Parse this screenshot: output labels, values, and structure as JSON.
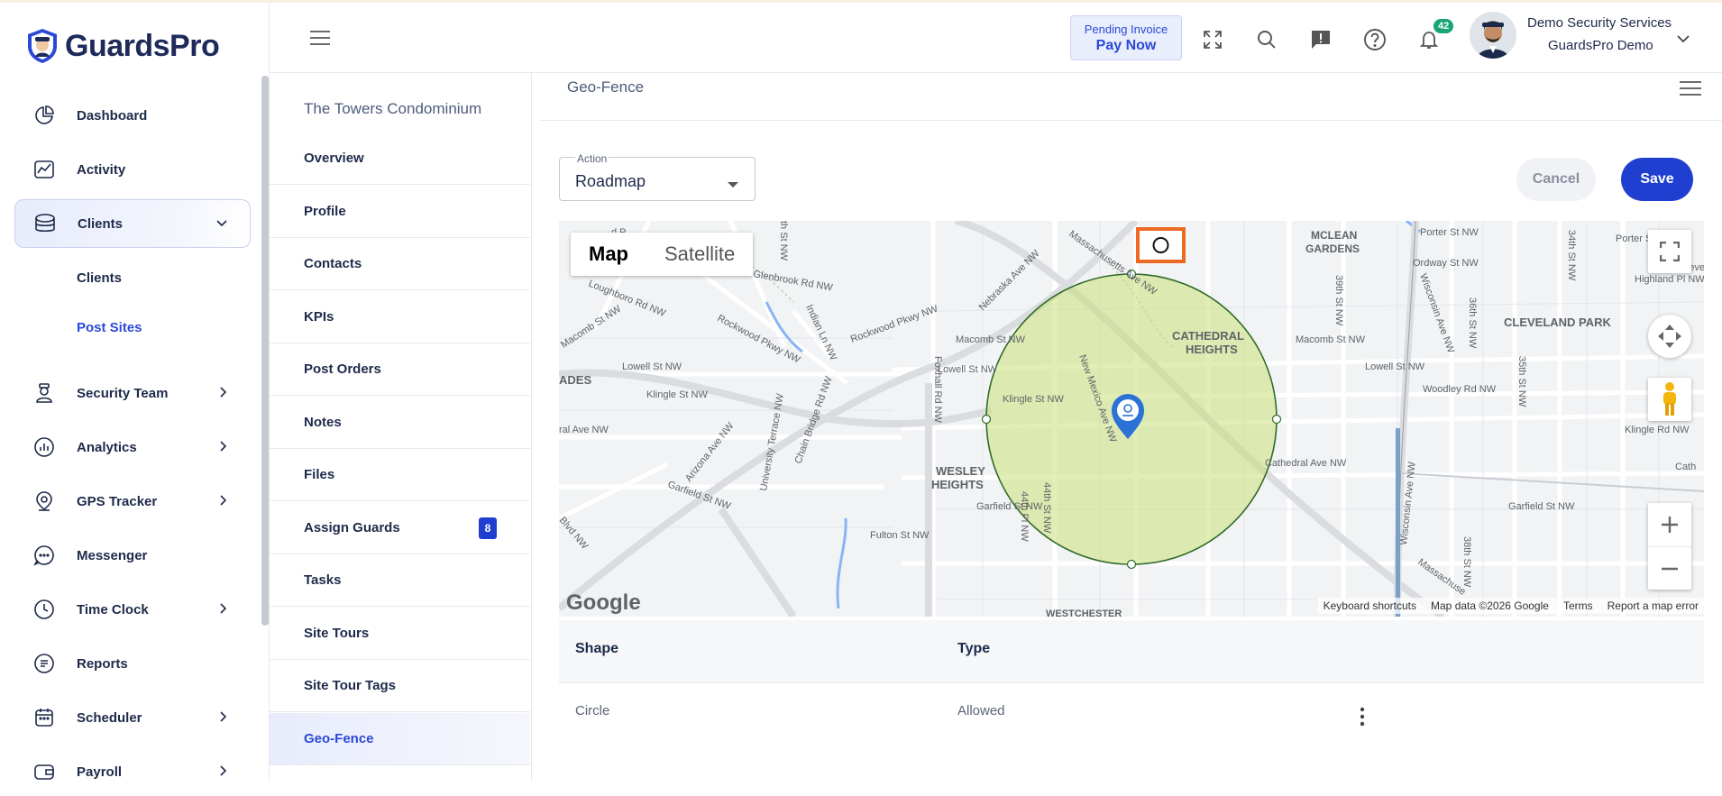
{
  "brand": {
    "name": "GuardsPro"
  },
  "sidebar": {
    "items": [
      {
        "label": "Dashboard",
        "icon": "dashboard-icon"
      },
      {
        "label": "Activity",
        "icon": "activity-icon"
      },
      {
        "label": "Clients",
        "icon": "clients-icon",
        "expanded": true
      },
      {
        "label": "Security Team",
        "icon": "security-team-icon"
      },
      {
        "label": "Analytics",
        "icon": "analytics-icon"
      },
      {
        "label": "GPS Tracker",
        "icon": "gps-tracker-icon"
      },
      {
        "label": "Messenger",
        "icon": "messenger-icon"
      },
      {
        "label": "Time Clock",
        "icon": "time-clock-icon"
      },
      {
        "label": "Reports",
        "icon": "reports-icon"
      },
      {
        "label": "Scheduler",
        "icon": "scheduler-icon"
      },
      {
        "label": "Payroll",
        "icon": "payroll-icon"
      }
    ],
    "sub_items": [
      {
        "label": "Clients"
      },
      {
        "label": "Post Sites",
        "active": true
      }
    ]
  },
  "header": {
    "invoice_line1": "Pending Invoice",
    "invoice_line2": "Pay Now",
    "notification_count": "42",
    "user_name": "Demo Security Services",
    "user_company": "GuardsPro Demo"
  },
  "site": {
    "title": "The Towers Condominium",
    "menu": [
      {
        "label": "Overview"
      },
      {
        "label": "Profile"
      },
      {
        "label": "Contacts"
      },
      {
        "label": "KPIs"
      },
      {
        "label": "Post Orders"
      },
      {
        "label": "Notes"
      },
      {
        "label": "Files"
      },
      {
        "label": "Assign Guards",
        "count": "8"
      },
      {
        "label": "Tasks"
      },
      {
        "label": "Site Tours"
      },
      {
        "label": "Site Tour Tags"
      },
      {
        "label": "Geo-Fence",
        "active": true
      }
    ]
  },
  "main": {
    "title": "Geo-Fence",
    "action_label": "Action",
    "action_value": "Roadmap",
    "cancel_label": "Cancel",
    "save_label": "Save"
  },
  "map": {
    "toggle_map": "Map",
    "toggle_satellite": "Satellite",
    "google": "Google",
    "keyboard": "Keyboard shortcuts",
    "mapdata": "Map data ©2026 Google",
    "terms": "Terms",
    "report": "Report a map error",
    "labels": {
      "mclean": "MCLEAN",
      "gardens": "GARDENS",
      "cleveland_park": "CLEVELAND PARK",
      "cathedral": "CATHEDRAL",
      "heights": "HEIGHTS",
      "wesley": "WESLEY",
      "wesley_heights": "HEIGHTS",
      "ades": "ADES",
      "porter": "Porter St NW",
      "porter2": "Porter St NW",
      "highland": "Highland Pl NW",
      "ordway": "Ordway St NW",
      "macomb1": "Macomb St NW",
      "macomb2": "Macomb St NW",
      "macomb3": "Macomb St NW",
      "lowell1": "Lowell St NW",
      "lowell2": "Lowell St NW",
      "lowell3": "Lowell St NW",
      "klingle1": "Klingle St NW",
      "klingle2": "Klingle St NW",
      "klingle_rd": "Klingle Rd NW",
      "woodley": "Woodley Rd NW",
      "cathedral_ave": "Cathedral Ave NW",
      "cathedral_ave2": "Cathedral Ave NW",
      "garfield1": "Garfield St NW",
      "garfield2": "Garfield St NW",
      "garfield3": "Garfield St NW",
      "fulton": "Fulton St NW",
      "glenbrook": "Glenbrook Rd NW",
      "rockwood": "Rockwood Pkwy NW",
      "rockwood2": "Rockwood Pkwy NW",
      "loughboro": "Loughboro Rd NW",
      "nebraska": "Nebraska Ave NW",
      "massachusetts": "Massachusetts Ave NW",
      "massachusetts2": "Massachuse",
      "newmexico": "New Mexico Ave NW",
      "foxhall": "Foxhall Rd NW",
      "arizona": "Arizona Ave NW",
      "wisconsin": "Wisconsin Ave NW",
      "wisconsin2": "Wisconsin Ave NW",
      "chainbridge": "Chain Bridge Rd NW",
      "univterr": "University Terrace NW",
      "indian": "Indian Ln NW",
      "ral": "ral Ave NW",
      "blvd": "Blvd NW",
      "s44": "44th St NW",
      "s44pl": "44th Pl NW",
      "s39": "39th St NW",
      "s38": "38th St NW",
      "s36": "36th St NW",
      "s35": "35th St NW",
      "s34": "34th St NW",
      "sthn": "th St NW",
      "cath": "Cath",
      "clevela": "Clevela",
      "westchester": "WESTCHESTER",
      "d_p": "d P"
    },
    "circle_color": "#cbe07a",
    "circle_stroke": "#2f6b2a"
  },
  "table": {
    "headers": [
      "Shape",
      "Type"
    ],
    "rows": [
      {
        "shape": "Circle",
        "type": "Allowed"
      }
    ]
  },
  "colors": {
    "primary": "#1f3fd0",
    "highlight": "#ee6a22",
    "badge": "#17a673"
  }
}
